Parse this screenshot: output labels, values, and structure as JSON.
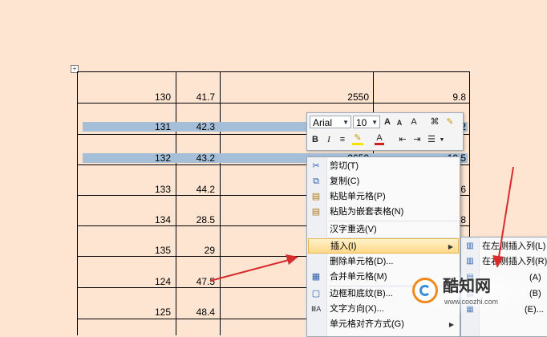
{
  "table": {
    "rows": [
      {
        "a": "130",
        "b": "41.7",
        "c": "2550",
        "d": "9.8",
        "selected": false
      },
      {
        "a": "131",
        "b": "42.3",
        "c": "",
        "d": "2",
        "selected": true
      },
      {
        "a": "132",
        "b": "43.2",
        "c": "2650",
        "d": "10.5",
        "selected": true
      },
      {
        "a": "133",
        "b": "44.2",
        "c": "",
        "d": "6",
        "selected": false
      },
      {
        "a": "134",
        "b": "28.5",
        "c": "",
        "d": "8",
        "selected": false
      },
      {
        "a": "135",
        "b": "29",
        "c": "",
        "d": "",
        "selected": false
      },
      {
        "a": "124",
        "b": "47.5",
        "c": "",
        "d": "",
        "selected": false
      },
      {
        "a": "125",
        "b": "48.4",
        "c": "",
        "d": "",
        "selected": false
      }
    ]
  },
  "mini_toolbar": {
    "font": "Arial",
    "size": "10",
    "grow_font": "A",
    "shrink_font": "A",
    "styles": "A",
    "bold": "B",
    "italic": "I",
    "center": "≡",
    "font_color": "A"
  },
  "context_menu": {
    "items": [
      {
        "label": "剪切(T)",
        "icon": "cut-icon",
        "glyph": "✂"
      },
      {
        "label": "复制(C)",
        "icon": "copy-icon",
        "glyph": "⧉"
      },
      {
        "label": "粘贴单元格(P)",
        "icon": "paste-icon",
        "glyph": "📋"
      },
      {
        "label": "粘贴为嵌套表格(N)",
        "icon": "paste-nested-icon",
        "glyph": "📋"
      },
      {
        "label": "汉字重选(V)",
        "icon": "",
        "glyph": ""
      },
      {
        "label": "插入(I)",
        "icon": "",
        "glyph": "",
        "submenu": true
      },
      {
        "label": "删除单元格(D)...",
        "icon": "",
        "glyph": ""
      },
      {
        "label": "合并单元格(M)",
        "icon": "merge-cells-icon",
        "glyph": "▦"
      },
      {
        "label": "边框和底纹(B)...",
        "icon": "borders-icon",
        "glyph": "▢"
      },
      {
        "label": "文字方向(X)...",
        "icon": "text-direction-icon",
        "glyph": "ⅢA"
      },
      {
        "label": "单元格对齐方式(G)",
        "icon": "",
        "glyph": "",
        "submenu": true
      }
    ]
  },
  "submenu": {
    "items": [
      {
        "label": "在左侧插入列(L)"
      },
      {
        "label": "在右侧插入列(R)"
      },
      {
        "label": "(A)"
      },
      {
        "label": "(B)"
      },
      {
        "label": "(E)..."
      }
    ]
  },
  "watermark": {
    "brand": "酷知网",
    "url": "www.coozhi.com"
  },
  "colors": {
    "background": "#fde5d2",
    "selection": "#a5bfd8",
    "annotation_arrow": "#d62c2c"
  }
}
